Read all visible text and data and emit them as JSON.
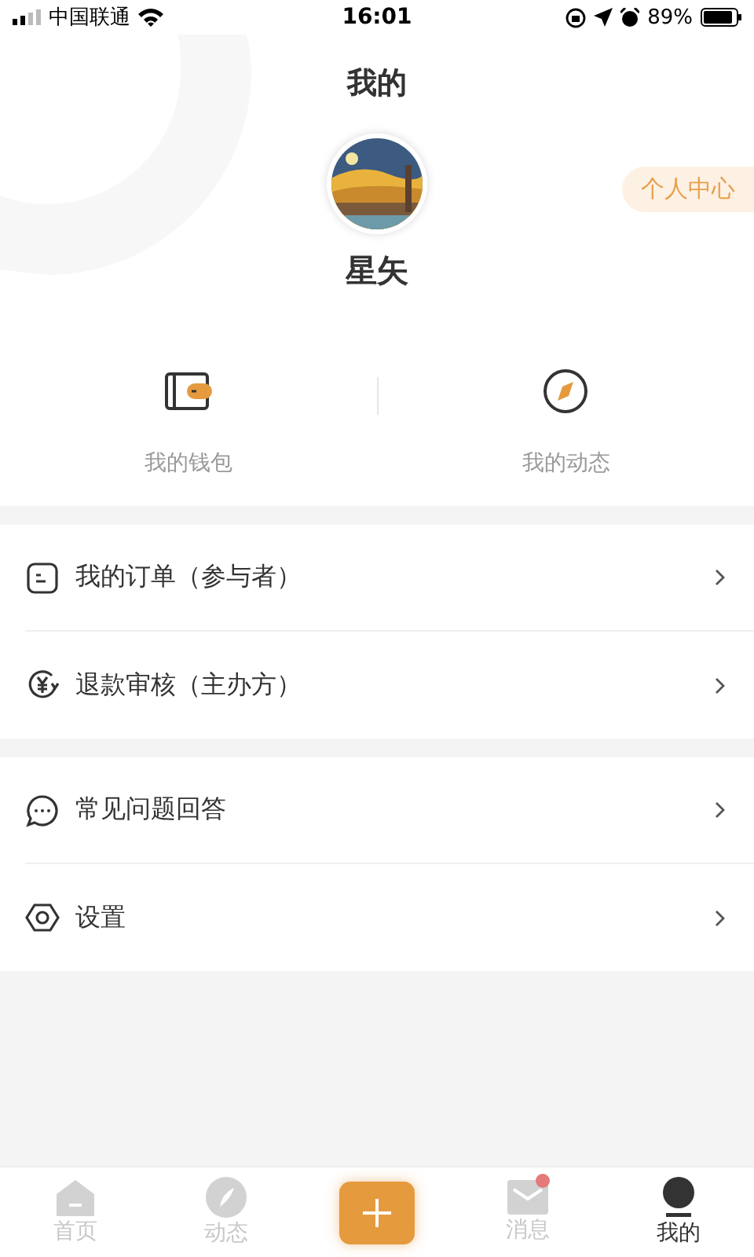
{
  "status_bar": {
    "carrier": "中国联通",
    "time": "16:01",
    "battery": "89%"
  },
  "header": {
    "title": "我的"
  },
  "profile": {
    "name": "星矢",
    "center_button": "个人中心"
  },
  "shortcuts": [
    {
      "kind": "wallet",
      "label": "我的钱包"
    },
    {
      "kind": "feed",
      "label": "我的动态"
    }
  ],
  "menu_groups": [
    [
      {
        "kind": "order",
        "label": "我的订单（参与者）"
      },
      {
        "kind": "refund",
        "label": "退款审核（主办方）"
      }
    ],
    [
      {
        "kind": "faq",
        "label": "常见问题回答"
      },
      {
        "kind": "settings",
        "label": "设置"
      }
    ]
  ],
  "tab_bar": [
    {
      "kind": "home",
      "label": "首页",
      "selected": false,
      "badge": false
    },
    {
      "kind": "feed",
      "label": "动态",
      "selected": false,
      "badge": false
    },
    {
      "kind": "add"
    },
    {
      "kind": "message",
      "label": "消息",
      "selected": false,
      "badge": true
    },
    {
      "kind": "profile",
      "label": "我的",
      "selected": true,
      "badge": false
    }
  ]
}
